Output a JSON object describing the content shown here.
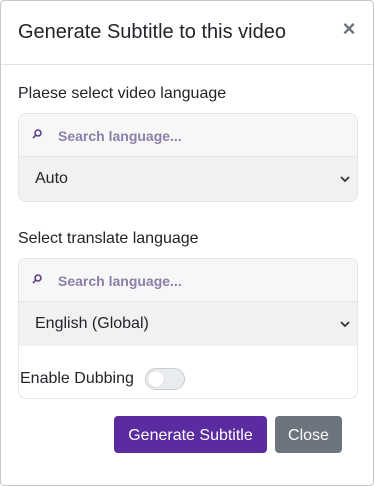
{
  "dialog": {
    "title": "Generate Subtitle to this video",
    "close_glyph": "×"
  },
  "video_language": {
    "label": "Plaese select video language",
    "search_placeholder": "Search language...",
    "selected": "Auto"
  },
  "translate_language": {
    "label": "Select translate language",
    "search_placeholder": "Search language...",
    "selected": "English (Global)"
  },
  "dubbing": {
    "label": "Enable Dubbing",
    "enabled": false
  },
  "footer": {
    "generate_label": "Generate Subtitle",
    "close_label": "Close"
  },
  "colors": {
    "primary": "#5b2ca0",
    "secondary": "#6c757d",
    "placeholder": "#8c7fa8"
  },
  "icons": {
    "close": "close-icon",
    "search": "search-icon",
    "chevron": "chevron-down-icon"
  }
}
